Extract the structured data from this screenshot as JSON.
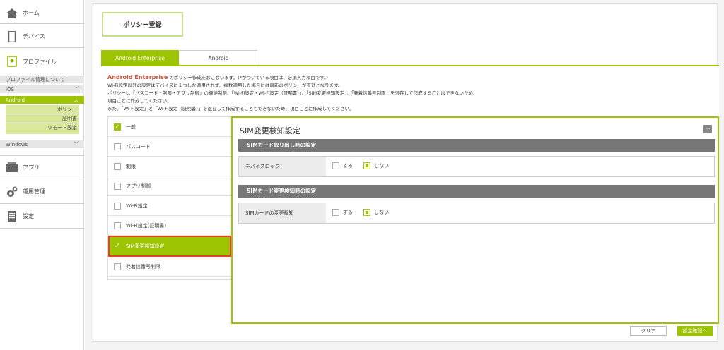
{
  "sidebar": {
    "home": "ホーム",
    "devices": "デバイス",
    "profile": "プロファイル",
    "profile_management": "プロファイル管理について",
    "ios": "iOS",
    "android": "Android",
    "android_sub": [
      "ポリシー",
      "証明書",
      "リモート設定"
    ],
    "windows": "Windows",
    "apps": "アプリ",
    "operations": "運用管理",
    "settings": "設定"
  },
  "page": {
    "title": "ポリシー登録",
    "tabs": [
      "Android Enterprise",
      "Android"
    ]
  },
  "intro": {
    "lead": "Android Enterprise",
    "line1_rest": " のポリシー作成をおこないます。(*がついている項目は、必須入力項目です。)",
    "line2": "Wi-Fi設定以外の設定はデバイスに１つしか適用されず、複数適用した場合には最新のポリシーが有効となります。",
    "line3": "ポリシーは「パスコード・制限・アプリ制御」の機能制限、「Wi-Fi設定・Wi-Fi設定（証明書）」、「SIM変更検知設定」、「発着信番号制限」を混在して作成することはできないため、",
    "line4": "項目ごとに作成してください。",
    "line5": "また、「Wi-Fi設定」と「Wi-Fi設定（証明書）」を混在して作成することもできないため、項目ごとに作成してください。"
  },
  "policy_items": [
    "一般",
    "パスコード",
    "制限",
    "アプリ制御",
    "Wi-Fi設定",
    "Wi-Fi設定(証明書)",
    "SIM変更検知設定",
    "発着信番号制限"
  ],
  "detail": {
    "title": "SIM変更検知設定",
    "collapse": "−",
    "section1": "SIMカード取り出し時の設定",
    "row1_label": "デバイスロック",
    "section2": "SIMカード変更検知時の設定",
    "row2_label": "SIMカードの変更検知",
    "opt_yes": "する",
    "opt_no": "しない",
    "selected": "しない"
  },
  "buttons": {
    "clear": "クリア",
    "confirm": "設定確認へ"
  },
  "colors": {
    "accent": "#9dc400",
    "highlight": "#e53e2a",
    "lead_text": "#c8503c"
  }
}
